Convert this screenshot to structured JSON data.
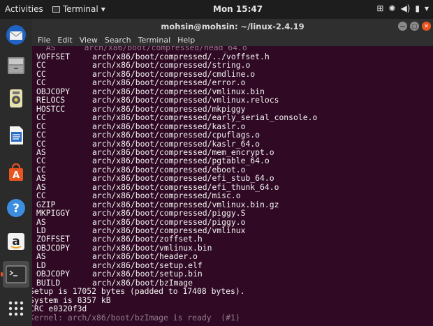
{
  "topbar": {
    "activities": "Activities",
    "app_name": "Terminal",
    "clock": "Mon 15:47"
  },
  "dock": {
    "items": [
      "thunderbird-icon",
      "files-icon",
      "rhythmbox-icon",
      "libreoffice-writer-icon",
      "software-center-icon",
      "help-icon",
      "amazon-icon",
      "terminal-icon",
      "show-apps-icon"
    ]
  },
  "window": {
    "title": "mohsin@mohsin: ~/linux-2.4.19",
    "menu": [
      "File",
      "Edit",
      "View",
      "Search",
      "Terminal",
      "Help"
    ]
  },
  "terminal": {
    "top_line": "  AS      arch/x86/boot/compressed/head_64.o",
    "build_lines": [
      [
        "VOFFSET",
        "arch/x86/boot/compressed/../voffset.h"
      ],
      [
        "CC",
        "arch/x86/boot/compressed/string.o"
      ],
      [
        "CC",
        "arch/x86/boot/compressed/cmdline.o"
      ],
      [
        "CC",
        "arch/x86/boot/compressed/error.o"
      ],
      [
        "OBJCOPY",
        "arch/x86/boot/compressed/vmlinux.bin"
      ],
      [
        "RELOCS",
        "arch/x86/boot/compressed/vmlinux.relocs"
      ],
      [
        "HOSTCC",
        "arch/x86/boot/compressed/mkpiggy"
      ],
      [
        "CC",
        "arch/x86/boot/compressed/early_serial_console.o"
      ],
      [
        "CC",
        "arch/x86/boot/compressed/kaslr.o"
      ],
      [
        "CC",
        "arch/x86/boot/compressed/cpuflags.o"
      ],
      [
        "CC",
        "arch/x86/boot/compressed/kaslr_64.o"
      ],
      [
        "AS",
        "arch/x86/boot/compressed/mem_encrypt.o"
      ],
      [
        "CC",
        "arch/x86/boot/compressed/pgtable_64.o"
      ],
      [
        "CC",
        "arch/x86/boot/compressed/eboot.o"
      ],
      [
        "AS",
        "arch/x86/boot/compressed/efi_stub_64.o"
      ],
      [
        "AS",
        "arch/x86/boot/compressed/efi_thunk_64.o"
      ],
      [
        "CC",
        "arch/x86/boot/compressed/misc.o"
      ],
      [
        "GZIP",
        "arch/x86/boot/compressed/vmlinux.bin.gz"
      ],
      [
        "MKPIGGY",
        "arch/x86/boot/compressed/piggy.S"
      ],
      [
        "AS",
        "arch/x86/boot/compressed/piggy.o"
      ],
      [
        "LD",
        "arch/x86/boot/compressed/vmlinux"
      ],
      [
        "ZOFFSET",
        "arch/x86/boot/zoffset.h"
      ],
      [
        "OBJCOPY",
        "arch/x86/boot/vmlinux.bin"
      ],
      [
        "AS",
        "arch/x86/boot/header.o"
      ],
      [
        "LD",
        "arch/x86/boot/setup.elf"
      ],
      [
        "OBJCOPY",
        "arch/x86/boot/setup.bin"
      ],
      [
        "BUILD",
        "arch/x86/boot/bzImage"
      ]
    ],
    "setup_line": "Setup is 17052 bytes (padded to 17408 bytes).",
    "system_line": "System is 8357 kB",
    "crc_line": "CRC e0320f3d",
    "kernel_line": "Kernel: arch/x86/boot/bzImage is ready  (#1)"
  },
  "colors": {
    "terminal_bg": "#300a24",
    "accent": "#e95420",
    "text": "#f4f4f4"
  }
}
